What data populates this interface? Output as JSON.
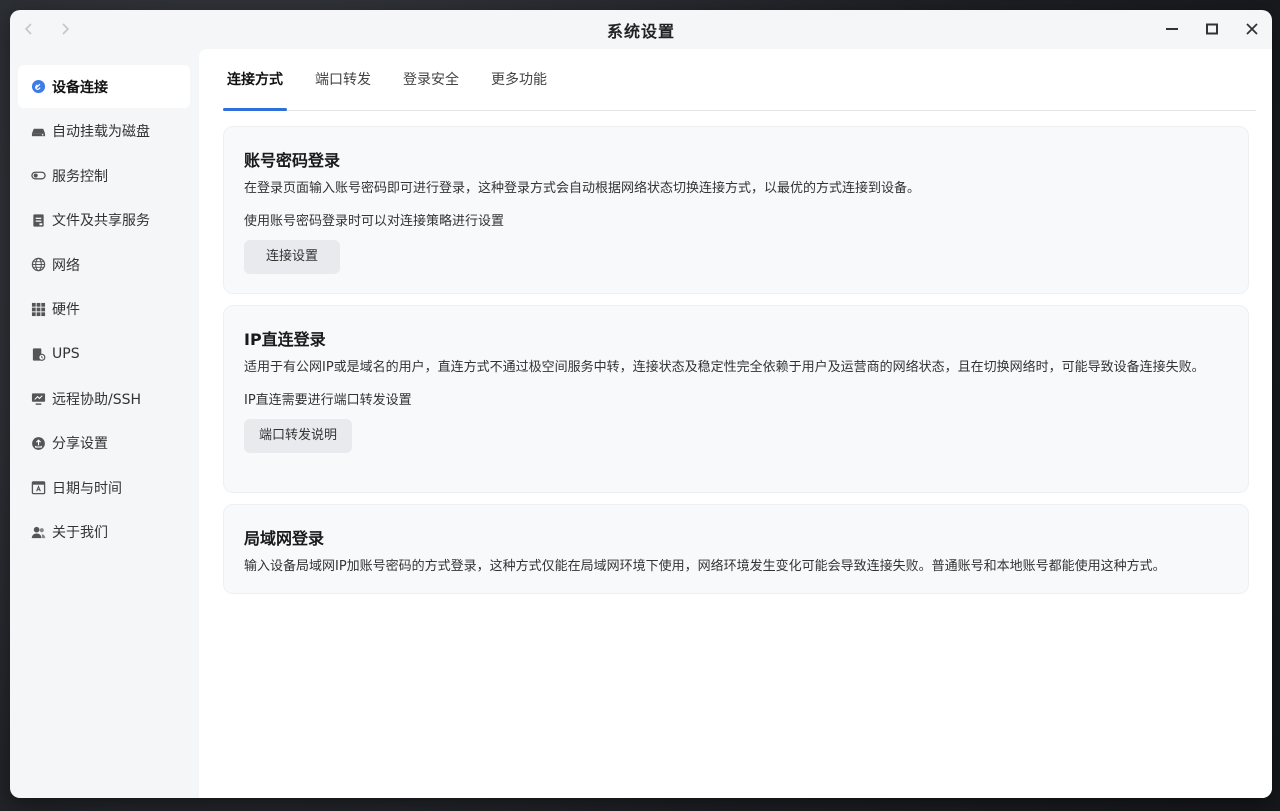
{
  "window": {
    "title": "系统设置",
    "nav": {
      "back_icon": "chevron-left-icon",
      "forward_icon": "chevron-right-icon"
    },
    "controls": [
      "minimize-icon",
      "maximize-icon",
      "close-icon"
    ]
  },
  "sidebar": {
    "items": [
      {
        "label": "设备连接",
        "icon": "link-icon",
        "active": true
      },
      {
        "label": "自动挂载为磁盘",
        "icon": "drive-icon"
      },
      {
        "label": "服务控制",
        "icon": "toggle-icon"
      },
      {
        "label": "文件及共享服务",
        "icon": "file-icon"
      },
      {
        "label": "网络",
        "icon": "globe-icon"
      },
      {
        "label": "硬件",
        "icon": "grid-icon"
      },
      {
        "label": "UPS",
        "icon": "battery-icon"
      },
      {
        "label": "远程协助/SSH",
        "icon": "monitor-icon"
      },
      {
        "label": "分享设置",
        "icon": "share-icon"
      },
      {
        "label": "日期与时间",
        "icon": "calendar-icon"
      },
      {
        "label": "关于我们",
        "icon": "users-icon"
      }
    ]
  },
  "tabs": [
    {
      "label": "连接方式",
      "active": true
    },
    {
      "label": "端口转发"
    },
    {
      "label": "登录安全"
    },
    {
      "label": "更多功能"
    }
  ],
  "cards": {
    "account": {
      "title": "账号密码登录",
      "desc": "在登录页面输入账号密码即可进行登录，这种登录方式会自动根据网络状态切换连接方式，以最优的方式连接到设备。",
      "sub": "使用账号密码登录时可以对连接策略进行设置",
      "button": "连接设置"
    },
    "ip": {
      "title": "IP直连登录",
      "desc": "适用于有公网IP或是域名的用户，直连方式不通过极空间服务中转，连接状态及稳定性完全依赖于用户及运营商的网络状态，且在切换网络时，可能导致设备连接失败。",
      "sub": "IP直连需要进行端口转发设置",
      "button": "端口转发说明"
    },
    "lan": {
      "title": "局域网登录",
      "desc": "输入设备局域网IP加账号密码的方式登录，这种方式仅能在局域网环境下使用，网络环境发生变化可能会导致连接失败。普通账号和本地账号都能使用这种方式。"
    }
  },
  "colors": {
    "accent": "#2f6fdc",
    "sidebar_bg": "#f5f6f8",
    "card_bg": "#f8f9fb"
  }
}
